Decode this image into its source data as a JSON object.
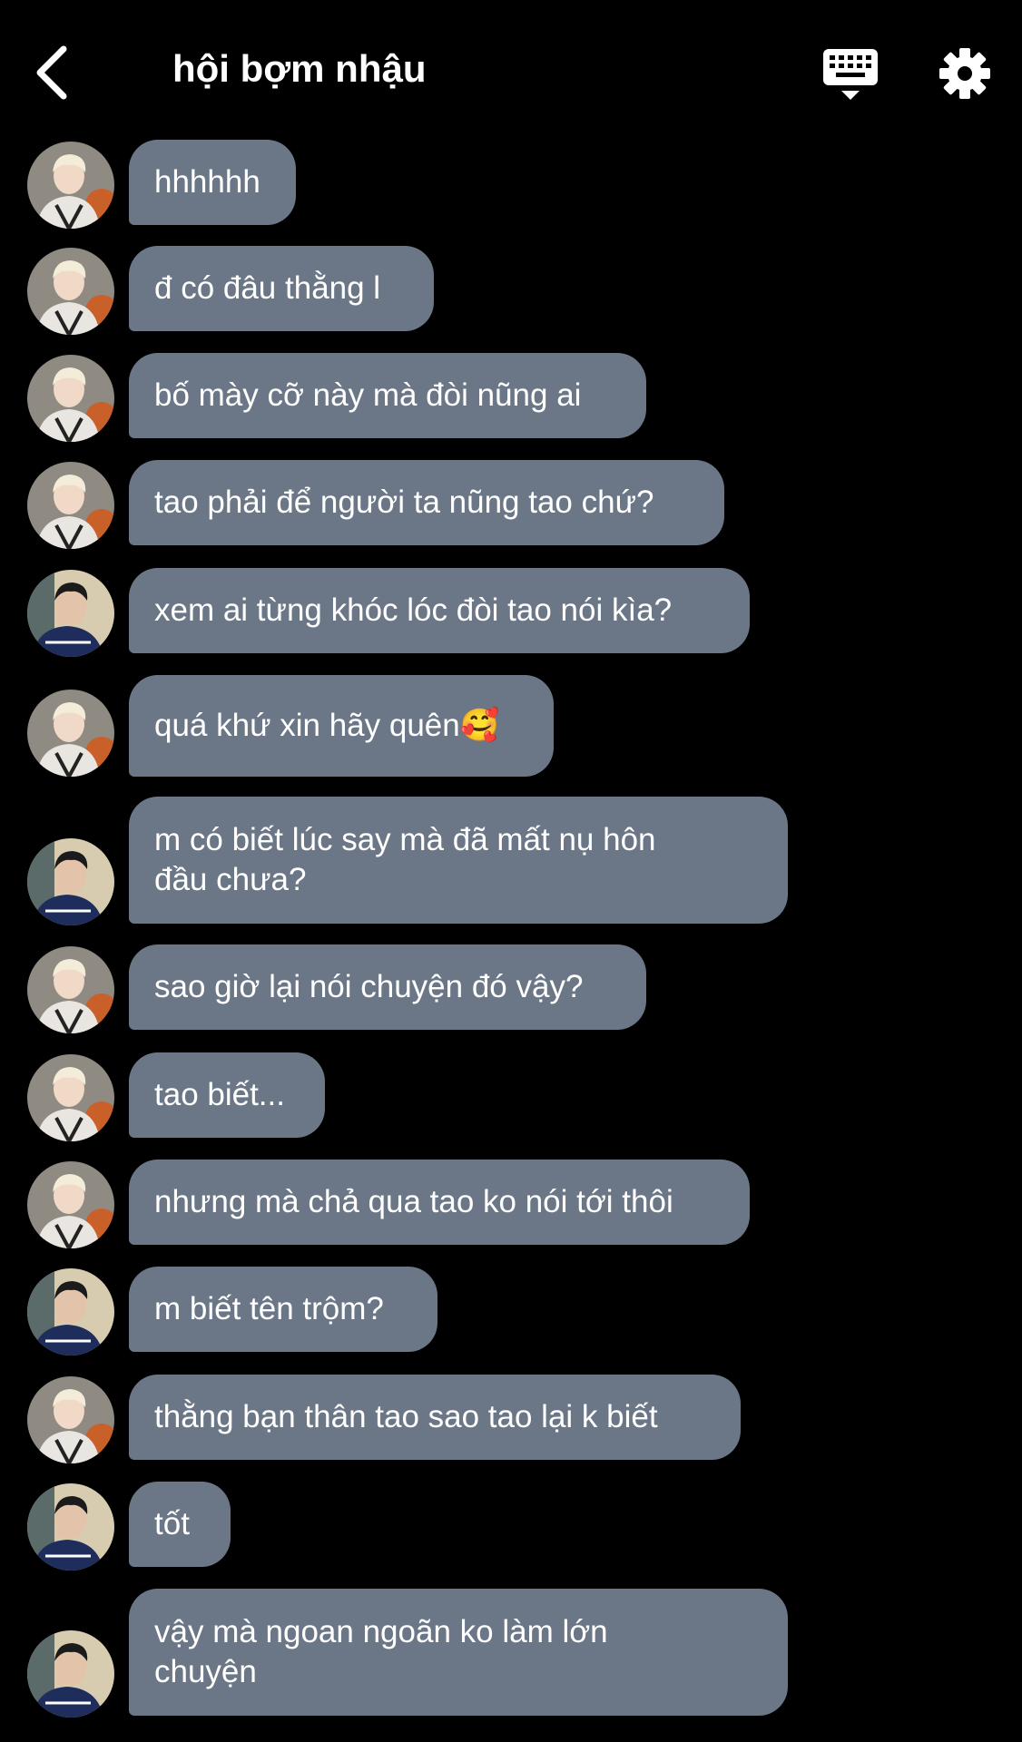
{
  "header": {
    "back_icon": "chevron-left-icon",
    "title": "hội bợm nhậu",
    "keyboard_icon": "keyboard-icon",
    "settings_icon": "gear-icon"
  },
  "colors": {
    "background": "#000000",
    "bubble": "#6b7787",
    "text": "#ffffff"
  },
  "messages": [
    {
      "sender": "blond",
      "text": "hhhhhh"
    },
    {
      "sender": "blond",
      "text": "đ có đâu thằng l"
    },
    {
      "sender": "blond",
      "text": "bố mày cỡ này mà đòi nũng ai"
    },
    {
      "sender": "blond",
      "text": "tao phải để người ta nũng tao chứ?"
    },
    {
      "sender": "dark",
      "text": "xem ai từng khóc lóc đòi tao nói kìa?"
    },
    {
      "sender": "blond",
      "text": "quá khứ xin hãy quên🥰"
    },
    {
      "sender": "dark",
      "text": "m có biết lúc say mà đã mất nụ hôn\nđầu chưa?"
    },
    {
      "sender": "blond",
      "text": "sao giờ lại nói chuyện đó vậy?"
    },
    {
      "sender": "blond",
      "text": "tao biết..."
    },
    {
      "sender": "blond",
      "text": "nhưng mà chả qua tao ko nói tới thôi"
    },
    {
      "sender": "dark",
      "text": "m biết tên trộm?"
    },
    {
      "sender": "blond",
      "text": "thằng bạn thân tao sao tao lại k biết"
    },
    {
      "sender": "dark",
      "text": "tốt"
    },
    {
      "sender": "dark",
      "text": "vậy mà ngoan ngoãn ko làm lớn\nchuyện"
    }
  ]
}
